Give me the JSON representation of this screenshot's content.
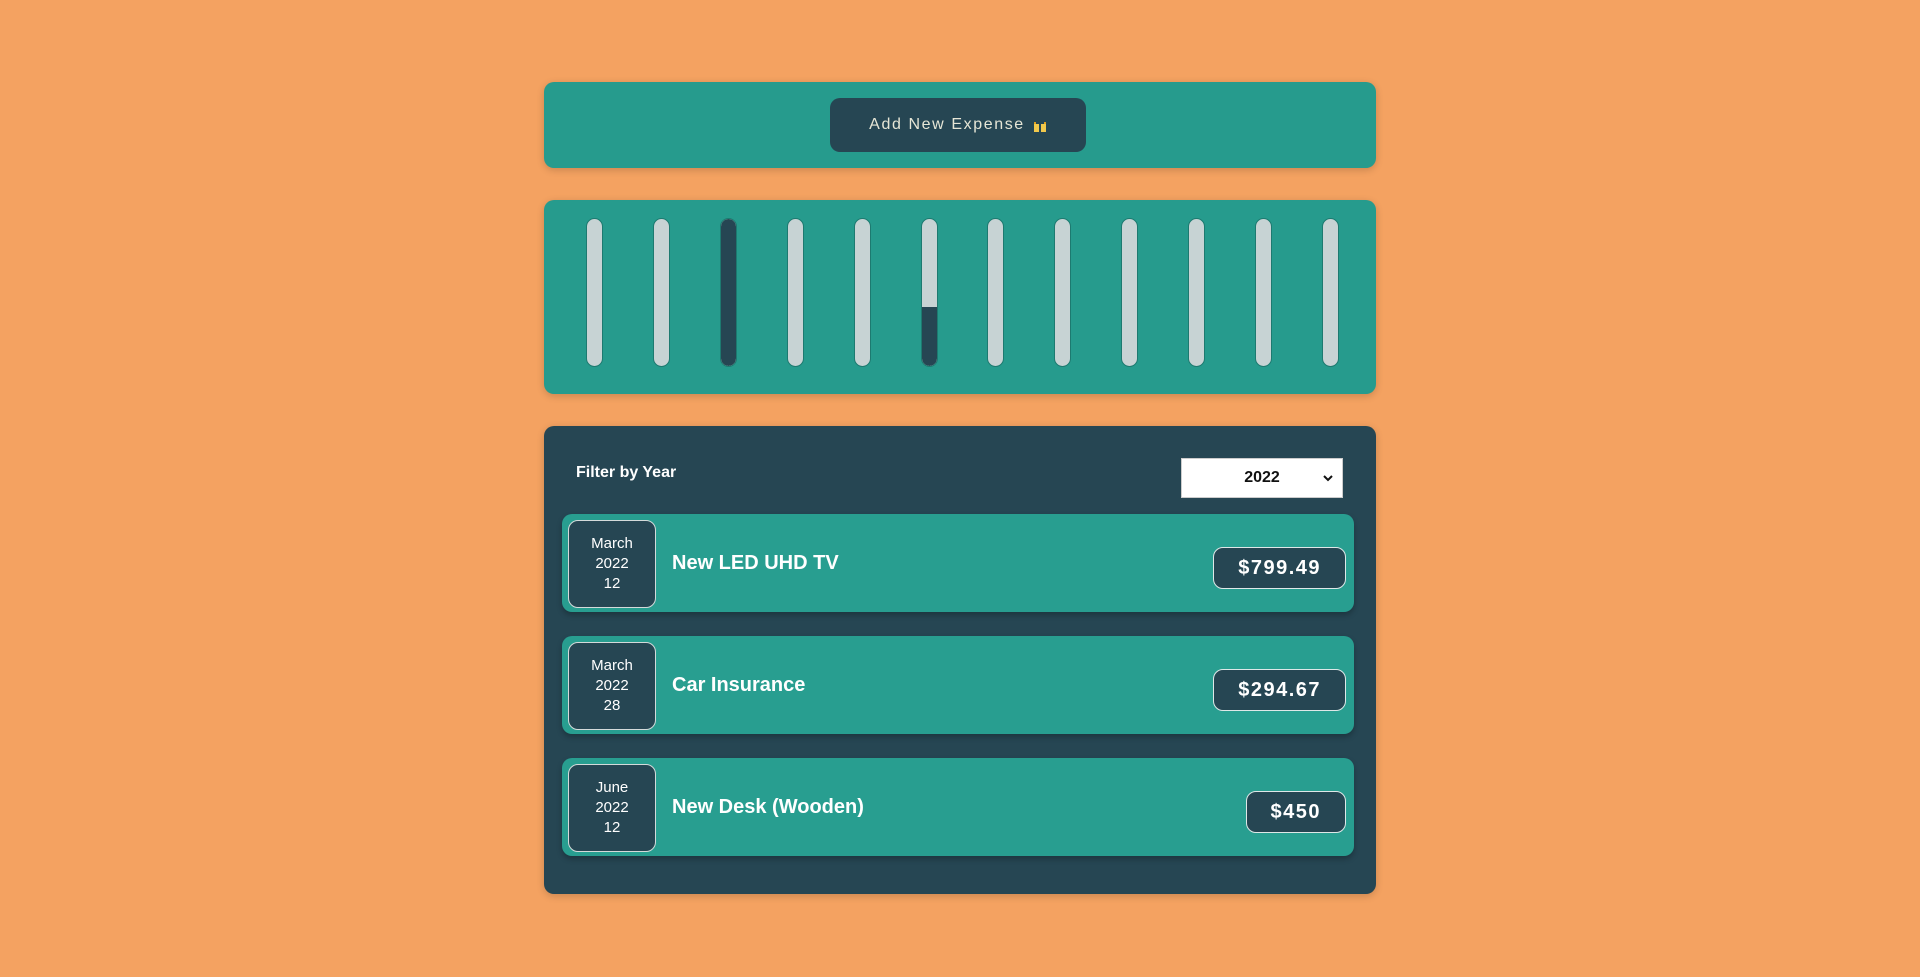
{
  "header": {
    "add_button_label": "Add New Expense",
    "add_button_icon": "money-icon"
  },
  "chart": {
    "months": [
      {
        "fill": 0
      },
      {
        "fill": 0
      },
      {
        "fill": 1.0
      },
      {
        "fill": 0
      },
      {
        "fill": 0
      },
      {
        "fill": 0.4
      },
      {
        "fill": 0
      },
      {
        "fill": 0
      },
      {
        "fill": 0
      },
      {
        "fill": 0
      },
      {
        "fill": 0
      },
      {
        "fill": 0
      }
    ]
  },
  "filter": {
    "label": "Filter by Year",
    "selected_year": "2022"
  },
  "expenses": [
    {
      "month": "March",
      "year": "2022",
      "day": "12",
      "title": "New LED UHD TV",
      "amount": "$799.49"
    },
    {
      "month": "March",
      "year": "2022",
      "day": "28",
      "title": "Car Insurance",
      "amount": "$294.67"
    },
    {
      "month": "June",
      "year": "2022",
      "day": "12",
      "title": "New Desk (Wooden)",
      "amount": "$450"
    }
  ],
  "colors": {
    "background": "#f4a261",
    "teal": "#269b8d",
    "dark": "#264653",
    "bar_empty": "#c7d3d4"
  }
}
